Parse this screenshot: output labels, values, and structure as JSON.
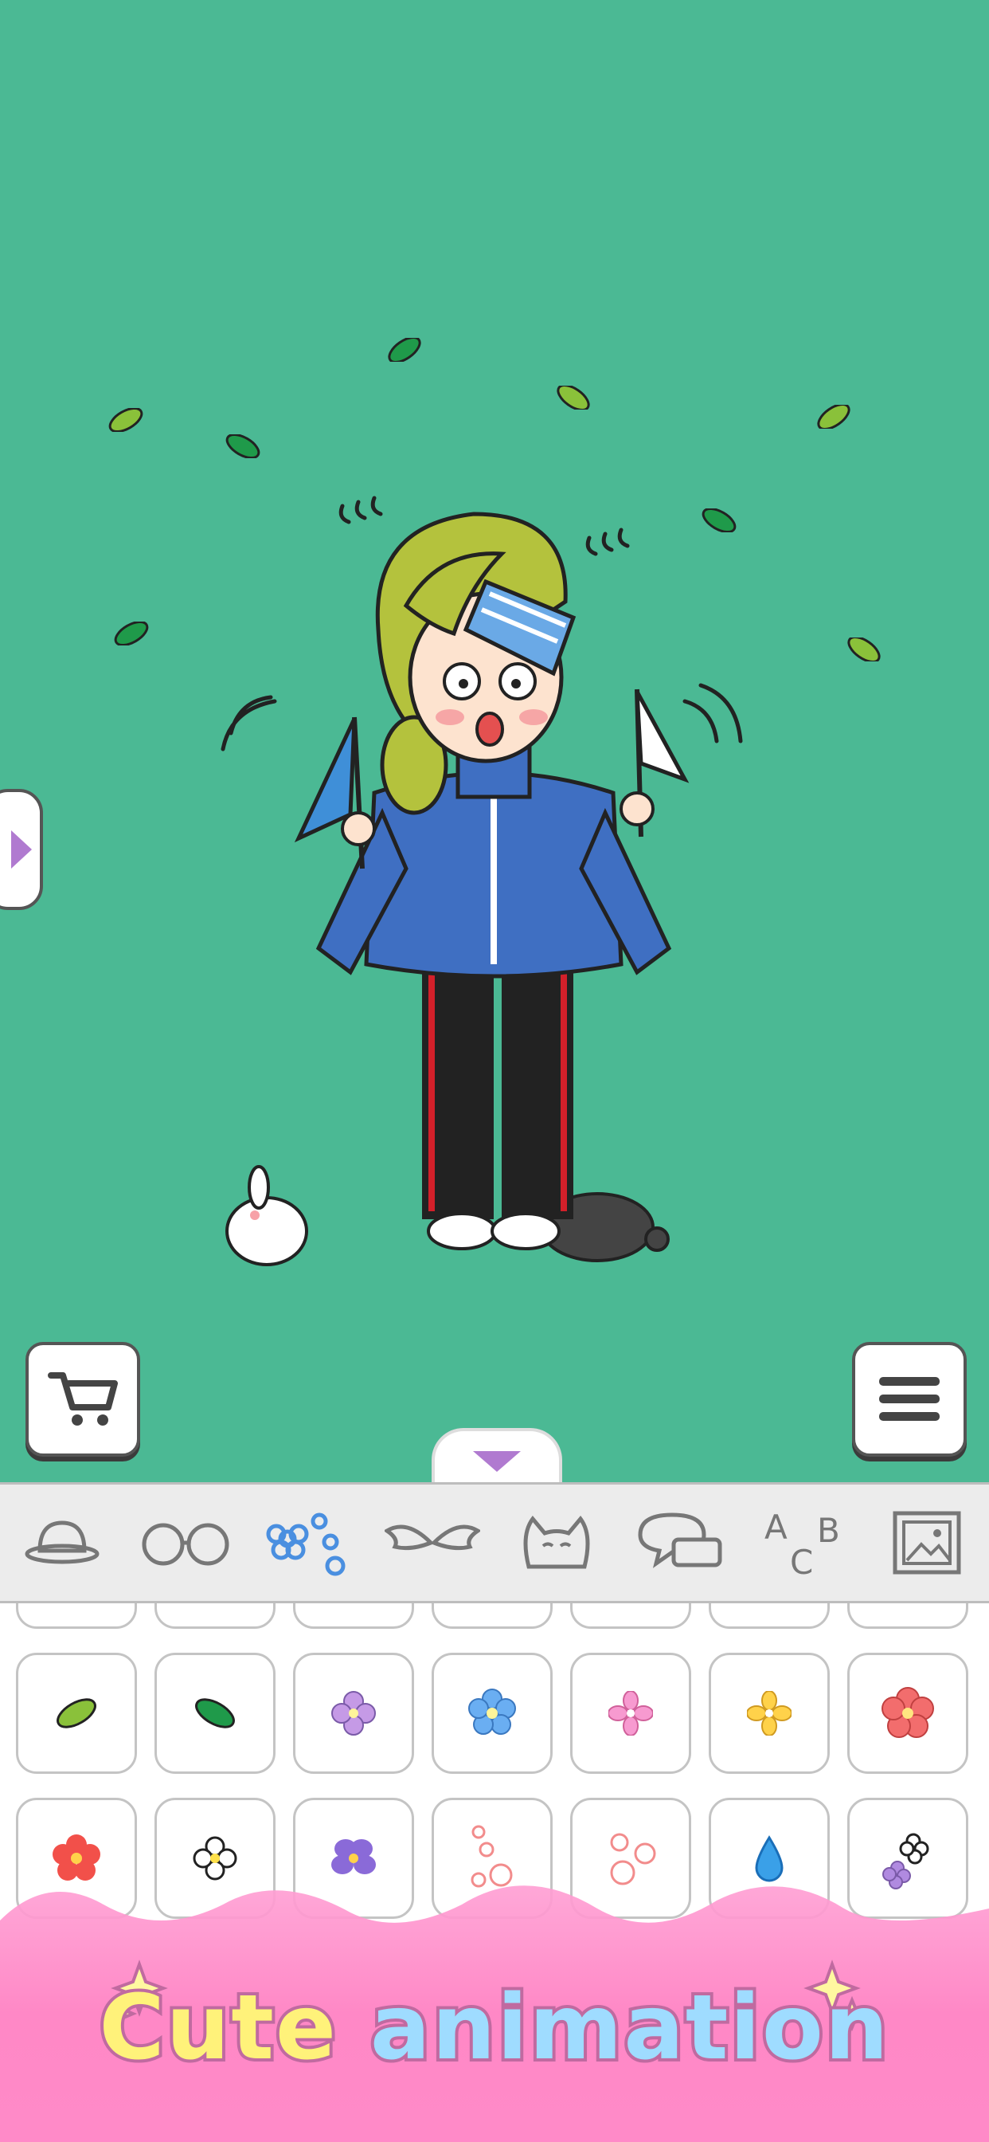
{
  "banner": {
    "word1": "Cute",
    "word2": "animation"
  },
  "toolbar": {
    "cart_icon": "cart-icon",
    "menu_icon": "hamburger-menu-icon",
    "side_tab_icon": "triangle-right-icon",
    "collapse_icon": "triangle-down-icon"
  },
  "categories": [
    {
      "icon": "hat-icon",
      "selected": false
    },
    {
      "icon": "glasses-icon",
      "selected": false
    },
    {
      "icon": "flowers-icon",
      "selected": true
    },
    {
      "icon": "wings-icon",
      "selected": false
    },
    {
      "icon": "cat-icon",
      "selected": false
    },
    {
      "icon": "speech-bubble-icon",
      "selected": false
    },
    {
      "icon": "abc-letters-icon",
      "selected": false
    },
    {
      "icon": "background-image-icon",
      "selected": false
    }
  ],
  "items_row1": [
    "leaf-light-green-icon",
    "leaf-dark-green-icon",
    "flower-purple-icon",
    "flower-blue-icon",
    "flower-pink-icon",
    "flower-yellow-icon",
    "flower-red-icon"
  ],
  "items_row2": [
    "flower-red-icon",
    "flower-white-icon",
    "pansy-purple-icon",
    "petals-pink-icon",
    "flowers-pink-icon",
    "water-drop-icon",
    "small-flowers-icon"
  ],
  "colors": {
    "stage_bg": "#4bb994",
    "selected_tab": "#4a8fe0",
    "banner_pink": "#ff8cc8"
  }
}
